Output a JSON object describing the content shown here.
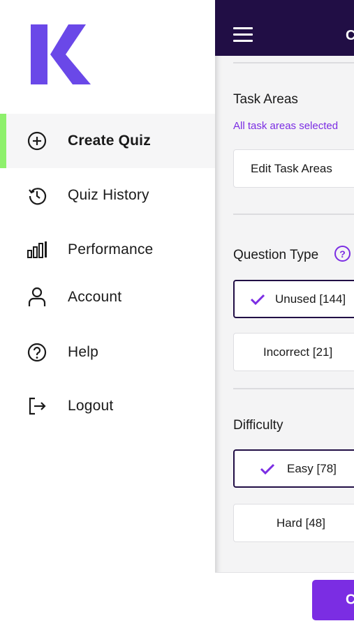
{
  "drawer": {
    "menu": [
      {
        "label": "Create Quiz",
        "icon": "plus-circle-icon",
        "active": true
      },
      {
        "label": "Quiz History",
        "icon": "history-icon",
        "active": false
      },
      {
        "label": "Performance",
        "icon": "bar-chart-icon",
        "active": false
      },
      {
        "label": "Account",
        "icon": "user-icon",
        "active": false
      },
      {
        "label": "Help",
        "icon": "question-circle-icon",
        "active": false
      },
      {
        "label": "Logout",
        "icon": "logout-icon",
        "active": false
      }
    ]
  },
  "main": {
    "header": {
      "title": "C"
    },
    "task_areas": {
      "title": "Task Areas",
      "selection_text": "All task areas selected",
      "edit_label": "Edit Task Areas"
    },
    "question_type": {
      "title": "Question Type",
      "help_glyph": "?",
      "options": [
        {
          "label": "Unused  [144]",
          "selected": true
        },
        {
          "label": "Incorrect  [21]",
          "selected": false
        }
      ]
    },
    "difficulty": {
      "title": "Difficulty",
      "options": [
        {
          "label": "Easy  [78]",
          "selected": true
        },
        {
          "label": "Hard  [48]",
          "selected": false
        }
      ]
    },
    "footer": {
      "cta_label": "C"
    }
  },
  "colors": {
    "brand_purple": "#7b2de3",
    "logo_purple": "#6a48e8",
    "header_dark": "#210e45",
    "active_indicator": "#8ef06c"
  }
}
